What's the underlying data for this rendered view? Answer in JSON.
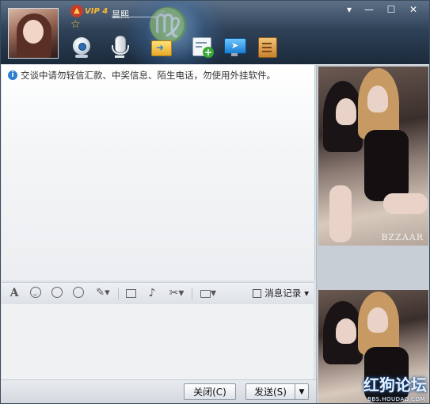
{
  "header": {
    "vip_label": "VIP 4",
    "nickname": "昙熙"
  },
  "window_controls": {
    "menu": "▾",
    "minimize": "—",
    "maximize": "☐",
    "close": "✕"
  },
  "toolbar_icons": [
    "webcam-icon",
    "microphone-icon",
    "send-file-icon",
    "notepad-add-icon",
    "remote-desktop-icon",
    "apps-icon"
  ],
  "chat": {
    "notice": "交谈中请勿轻信汇款、中奖信息、陌生电话，勿使用外挂软件。"
  },
  "input_toolbar": {
    "font_glyph": "A",
    "edit_glyph": "✎▾",
    "shake_glyph": "♪",
    "cut_glyph": "✂▾",
    "tools_glyph": "▾",
    "history_label": "消息记录",
    "history_arrow": "▾"
  },
  "buttons": {
    "close_label": "关闭(C)",
    "send_label": "发送(S)",
    "send_menu": "▼"
  },
  "side_panel": {
    "photo_watermark": "BZZAAR",
    "site_mark": "红狗论坛",
    "site_mark_sub": "BBS.HOUDAO.COM"
  }
}
